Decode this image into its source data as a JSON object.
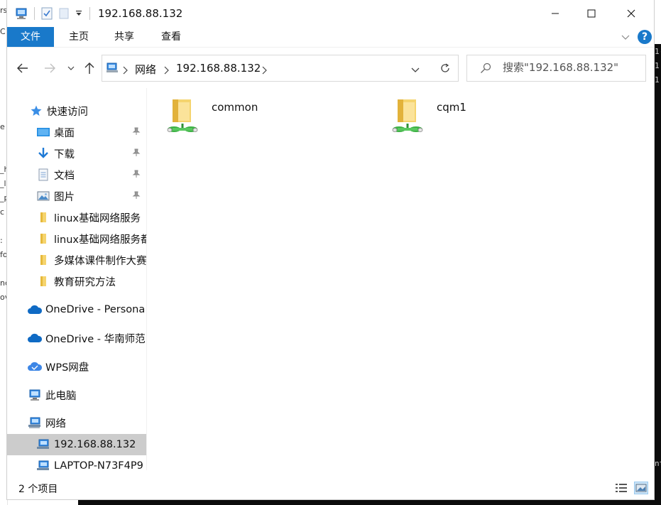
{
  "window": {
    "title": "192.168.88.132"
  },
  "ribbon": {
    "tabs": [
      "文件",
      "主页",
      "共享",
      "查看"
    ]
  },
  "address_bar": {
    "segments": [
      "网络",
      "192.168.88.132"
    ]
  },
  "search": {
    "placeholder": "搜索\"192.168.88.132\""
  },
  "nav_pane": {
    "quick_access": "快速访问",
    "pinned": [
      {
        "label": "桌面",
        "icon": "desktop-icon"
      },
      {
        "label": "下载",
        "icon": "download-icon"
      },
      {
        "label": "文档",
        "icon": "document-icon"
      },
      {
        "label": "图片",
        "icon": "picture-icon"
      }
    ],
    "recent_folders": [
      "linux基础网络服务",
      "linux基础网络服务都",
      "多媒体课件制作大赛",
      "教育研究方法"
    ],
    "onedrive_personal": "OneDrive - Persona",
    "onedrive_org": "OneDrive - 华南师范",
    "wps": "WPS网盘",
    "this_pc": "此电脑",
    "network": "网络",
    "network_children": [
      "192.168.88.132",
      "LAPTOP-N73F4P9"
    ],
    "selected": "192.168.88.132"
  },
  "content": {
    "items": [
      "common",
      "cqm1"
    ]
  },
  "status_bar": {
    "count_text": "2 个项目"
  },
  "colors": {
    "accent": "#1979ca",
    "selection": "#cccccc",
    "folder": "#f5d46e",
    "network_green": "#3cb043"
  },
  "background": {
    "left_fragments": [
      "rs",
      "C",
      "e",
      "_h",
      "_lc",
      "_p",
      "c",
      ":",
      "fo",
      "nc",
      "ov"
    ],
    "right_fragments": [
      "1(",
      "1:",
      "1:",
      "nt"
    ]
  }
}
